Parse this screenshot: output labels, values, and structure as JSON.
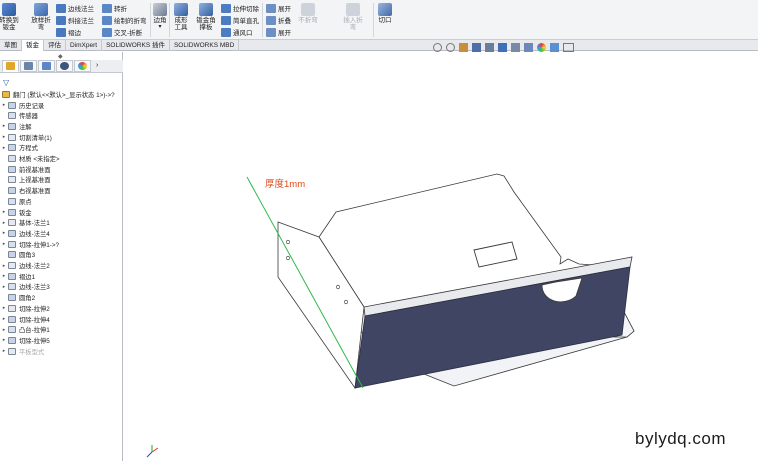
{
  "ribbon": {
    "big_buttons": [
      {
        "label": "转换到钣金",
        "icon": "convert-sheet-icon"
      },
      {
        "label": "放样折弯",
        "icon": "lofted-bend-icon"
      },
      {
        "label": "边角",
        "icon": "corner-icon"
      },
      {
        "label": "成形工具",
        "icon": "forming-tool-icon"
      },
      {
        "label": "钣金角撑板",
        "icon": "gusset-icon"
      },
      {
        "label": "不折弯",
        "icon": "no-bend-icon"
      },
      {
        "label": "插入折弯",
        "icon": "insert-bend-icon"
      },
      {
        "label": "切口",
        "icon": "rip-icon"
      }
    ],
    "small_buttons": [
      {
        "label": "边线法兰",
        "icon": "edge-flange-icon"
      },
      {
        "label": "斜接法兰",
        "icon": "miter-flange-icon"
      },
      {
        "label": "褶边",
        "icon": "hem-icon"
      },
      {
        "label": "转折",
        "icon": "jog-icon"
      },
      {
        "label": "绘制的折弯",
        "icon": "sketched-bend-icon"
      },
      {
        "label": "交叉-折断",
        "icon": "cross-break-icon"
      },
      {
        "label": "拉伸切除",
        "icon": "extruded-cut-icon"
      },
      {
        "label": "简单直孔",
        "icon": "simple-hole-icon"
      },
      {
        "label": "通风口",
        "icon": "vent-icon"
      },
      {
        "label": "展开",
        "icon": "unfold-icon"
      },
      {
        "label": "折叠",
        "icon": "fold-icon"
      },
      {
        "label": "展开",
        "icon": "flatten-icon"
      }
    ]
  },
  "tabs": [
    "草图",
    "钣金",
    "评估",
    "DimXpert",
    "SOLIDWORKS 插件",
    "SOLIDWORKS MBD"
  ],
  "active_tab": "钣金",
  "tree": {
    "root": "翻门 (默认<<默认>_显示状态 1>)->?",
    "items": [
      {
        "label": "历史记录",
        "expand": true
      },
      {
        "label": "传感器",
        "expand": false
      },
      {
        "label": "注解",
        "expand": true
      },
      {
        "label": "切割清单(1)",
        "expand": true
      },
      {
        "label": "方程式",
        "expand": true
      },
      {
        "label": "材质 <未指定>",
        "expand": false
      },
      {
        "label": "前视基准面",
        "expand": false
      },
      {
        "label": "上视基准面",
        "expand": false
      },
      {
        "label": "右视基准面",
        "expand": false
      },
      {
        "label": "原点",
        "expand": false
      },
      {
        "label": "钣金",
        "expand": true
      },
      {
        "label": "基体-法兰1",
        "expand": true
      },
      {
        "label": "边线-法兰4",
        "expand": true
      },
      {
        "label": "切除-拉伸1->?",
        "expand": true
      },
      {
        "label": "圆角3",
        "expand": false
      },
      {
        "label": "边线-法兰2",
        "expand": true
      },
      {
        "label": "褶边1",
        "expand": true
      },
      {
        "label": "边线-法兰3",
        "expand": true
      },
      {
        "label": "圆角2",
        "expand": false
      },
      {
        "label": "切除-拉伸2",
        "expand": true
      },
      {
        "label": "切除-拉伸4",
        "expand": true
      },
      {
        "label": "凸台-拉伸1",
        "expand": true
      },
      {
        "label": "切除-拉伸5",
        "expand": true
      },
      {
        "label": "平板型式",
        "expand": true,
        "dim": true
      }
    ]
  },
  "annotation": "厚度1mm",
  "watermark": "bylydq.com",
  "colors": {
    "accent": "#1f5fa8",
    "side_face": "#3f4562",
    "annotation": "#e04a1a",
    "edge_green": "#2fb84a"
  }
}
